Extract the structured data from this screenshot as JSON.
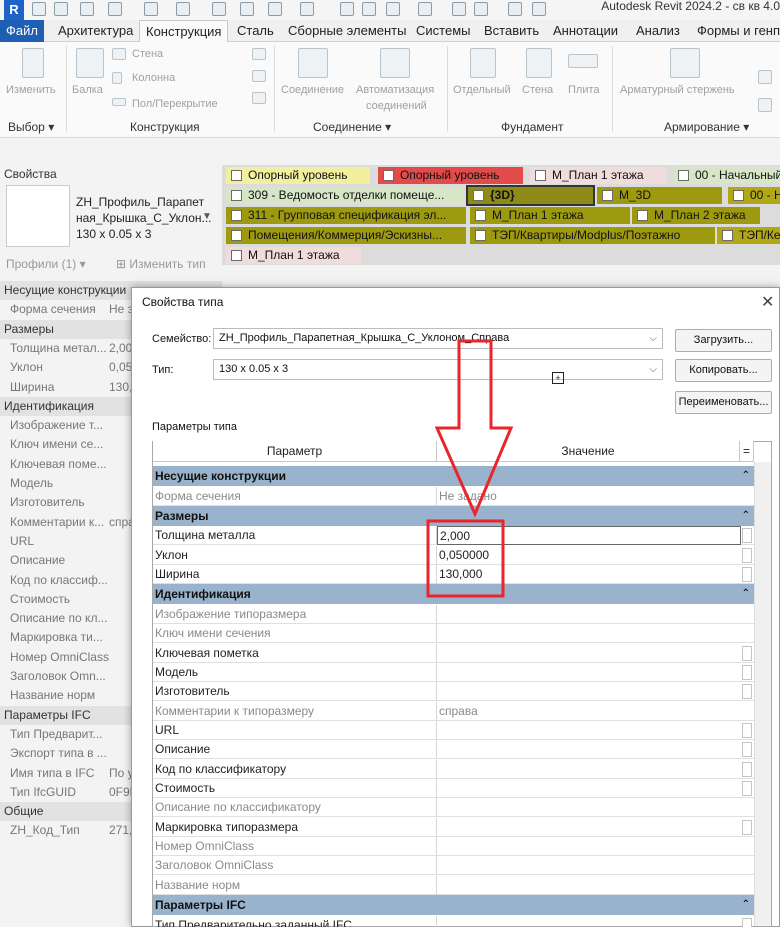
{
  "app": {
    "logo": "R",
    "title": "Autodesk Revit 2024.2 - св кв 4.0"
  },
  "ribbon_tabs": [
    "Файл",
    "Архитектура",
    "Конструкция",
    "Сталь",
    "Сборные элементы",
    "Системы",
    "Вставить",
    "Аннотации",
    "Анализ",
    "Формы и генплан"
  ],
  "ribbon": {
    "buttons": {
      "modify": "Изменить",
      "beam": "Балка",
      "wall": "Стена",
      "column": "Колонна",
      "floor": "Пол/Перекрытие",
      "connection": "Соединение",
      "auto_connection_1": "Автоматизация",
      "auto_connection_2": "соединений",
      "isolated": "Отдельный",
      "found_wall": "Стена",
      "slab": "Плита",
      "rebar": "Арматурный стержень"
    },
    "panels": {
      "select": "Выбор",
      "structure": "Конструкция",
      "connection": "Соединение",
      "foundation": "Фундамент",
      "reinforcement": "Армирование"
    }
  },
  "properties": {
    "title": "Свойства",
    "type_line1": "ZH_Профиль_Парапет",
    "type_line2": "ная_Крышка_С_Уклон...",
    "type_line3": "130 x 0.05 x 3",
    "filter": "Профили (1)",
    "edit_type": "Изменить тип",
    "rows": [
      {
        "kind": "group",
        "label": "Несущие конструкции"
      },
      {
        "kind": "row",
        "name": "Форма сечения",
        "value": "Не з"
      },
      {
        "kind": "group",
        "label": "Размеры"
      },
      {
        "kind": "row",
        "name": "Толщина метал...",
        "value": "2,000"
      },
      {
        "kind": "row",
        "name": "Уклон",
        "value": "0,050"
      },
      {
        "kind": "row",
        "name": "Ширина",
        "value": "130,0"
      },
      {
        "kind": "group",
        "label": "Идентификация"
      },
      {
        "kind": "row",
        "name": "Изображение т...",
        "value": ""
      },
      {
        "kind": "row",
        "name": "Ключ имени се...",
        "value": ""
      },
      {
        "kind": "row",
        "name": "Ключевая поме...",
        "value": ""
      },
      {
        "kind": "row",
        "name": "Модель",
        "value": ""
      },
      {
        "kind": "row",
        "name": "Изготовитель",
        "value": ""
      },
      {
        "kind": "row",
        "name": "Комментарии к...",
        "value": "спра"
      },
      {
        "kind": "row",
        "name": "URL",
        "value": ""
      },
      {
        "kind": "row",
        "name": "Описание",
        "value": ""
      },
      {
        "kind": "row",
        "name": "Код по классиф...",
        "value": ""
      },
      {
        "kind": "row",
        "name": "Стоимость",
        "value": ""
      },
      {
        "kind": "row",
        "name": "Описание по кл...",
        "value": ""
      },
      {
        "kind": "row",
        "name": "Маркировка ти...",
        "value": ""
      },
      {
        "kind": "row",
        "name": "Номер OmniClass",
        "value": ""
      },
      {
        "kind": "row",
        "name": "Заголовок Omn...",
        "value": ""
      },
      {
        "kind": "row",
        "name": "Название норм",
        "value": ""
      },
      {
        "kind": "group",
        "label": "Параметры IFC"
      },
      {
        "kind": "row",
        "name": "Тип Предварит...",
        "value": ""
      },
      {
        "kind": "row",
        "name": "Экспорт типа в ...",
        "value": ""
      },
      {
        "kind": "row",
        "name": "Имя типа в IFC",
        "value": "По у"
      },
      {
        "kind": "row",
        "name": "Тип IfcGUID",
        "value": "0F9F"
      },
      {
        "kind": "group",
        "label": "Общие"
      },
      {
        "kind": "row",
        "name": "ZH_Код_Тип",
        "value": "271,"
      }
    ]
  },
  "view_tabs": [
    {
      "label": "Опорный уровень",
      "color": "yellow"
    },
    {
      "label": "Опорный уровень",
      "color": "red"
    },
    {
      "label": "М_План 1 этажа",
      "color": "pink"
    },
    {
      "label": "00 - Начальный",
      "color": "green"
    },
    {
      "label": "309 - Ведомость отделки помеще...",
      "color": "green"
    },
    {
      "label": "{3D}",
      "color": "active"
    },
    {
      "label": "М_3D",
      "color": "olive"
    },
    {
      "label": "00 - Н",
      "color": "olive2"
    },
    {
      "label": "311 - Групповая спецификация эл...",
      "color": "olive"
    },
    {
      "label": "М_План 1 этажа",
      "color": "olive"
    },
    {
      "label": "М_План 2 этажа",
      "color": "olive"
    },
    {
      "label": "Помещения/Коммерция/Эскизны...",
      "color": "olive"
    },
    {
      "label": "ТЭП/Квартиры/Modplus/Поэтажно",
      "color": "olive"
    },
    {
      "label": "ТЭП/Ке",
      "color": "olive2"
    },
    {
      "label": "М_План 1 этажа",
      "color": "pink"
    }
  ],
  "dialog": {
    "title": "Свойства типа",
    "family_label": "Семейство:",
    "family_value": "ZH_Профиль_Парапетная_Крышка_С_Уклоном_Справа",
    "type_label": "Тип:",
    "type_value": "130 x 0.05 x 3",
    "load_button": "Загрузить...",
    "copy_button": "Копировать...",
    "rename_button": "Переименовать...",
    "params_label": "Параметры типа",
    "col_param": "Параметр",
    "col_value": "Значение",
    "sections": [
      {
        "title": "Несущие конструкции",
        "rows": [
          {
            "name": "Форма сечения",
            "value": "Не задано",
            "dim": true
          }
        ]
      },
      {
        "title": "Размеры",
        "rows": [
          {
            "name": "Толщина металла",
            "value": "2,000",
            "dim": false,
            "boxed": true
          },
          {
            "name": "Уклон",
            "value": "0,050000",
            "dim": false
          },
          {
            "name": "Ширина",
            "value": "130,000",
            "dim": false
          }
        ]
      },
      {
        "title": "Идентификация",
        "rows": [
          {
            "name": "Изображение типоразмера",
            "value": "",
            "dim": true
          },
          {
            "name": "Ключ имени сечения",
            "value": "",
            "dim": true
          },
          {
            "name": "Ключевая пометка",
            "value": "",
            "dim": false
          },
          {
            "name": "Модель",
            "value": "",
            "dim": false
          },
          {
            "name": "Изготовитель",
            "value": "",
            "dim": false
          },
          {
            "name": "Комментарии к типоразмеру",
            "value": "справа",
            "dim": true
          },
          {
            "name": "URL",
            "value": "",
            "dim": false
          },
          {
            "name": "Описание",
            "value": "",
            "dim": false
          },
          {
            "name": "Код по классификатору",
            "value": "",
            "dim": false
          },
          {
            "name": "Стоимость",
            "value": "",
            "dim": false
          },
          {
            "name": "Описание по классификатору",
            "value": "",
            "dim": true
          },
          {
            "name": "Маркировка типоразмера",
            "value": "",
            "dim": false
          },
          {
            "name": "Номер OmniClass",
            "value": "",
            "dim": true
          },
          {
            "name": "Заголовок OmniClass",
            "value": "",
            "dim": true
          },
          {
            "name": "Название норм",
            "value": "",
            "dim": true
          }
        ]
      },
      {
        "title": "Параметры IFC",
        "rows": [
          {
            "name": "Тип Предварительно заданный IFC",
            "value": "",
            "dim": false
          }
        ]
      }
    ]
  },
  "colors": {
    "file_tab": "#1e5fb4",
    "section_header": "#9ab3cc",
    "annotation": "#e8262c"
  }
}
